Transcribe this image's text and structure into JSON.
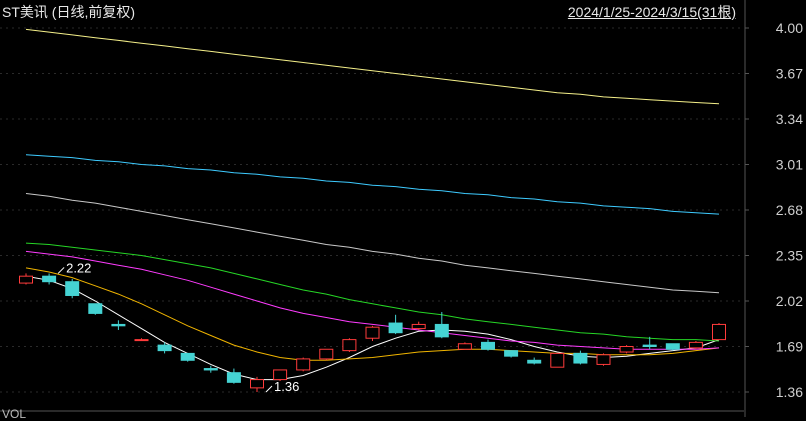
{
  "header": {
    "title": "ST美讯 (日线,前复权)",
    "range": "2024/1/25-2024/3/15(31根)"
  },
  "footer_label": "VOL",
  "colors": {
    "up": "#ff3b3b",
    "down": "#45d3d3",
    "grid": "#2a2a2a",
    "axis": "#555555"
  },
  "chart_data": {
    "type": "candlestick",
    "y_ticks": [
      "4.00",
      "3.67",
      "3.34",
      "3.01",
      "2.68",
      "2.35",
      "2.02",
      "1.69",
      "1.36"
    ],
    "ylim": [
      1.3,
      4.08
    ],
    "grid": true,
    "candles": [
      {
        "open": 2.15,
        "close": 2.2,
        "high": 2.22,
        "low": 2.14
      },
      {
        "open": 2.2,
        "close": 2.16,
        "high": 2.22,
        "low": 2.14
      },
      {
        "open": 2.16,
        "close": 2.06,
        "high": 2.18,
        "low": 2.04
      },
      {
        "open": 2.0,
        "close": 1.93,
        "high": 2.0,
        "low": 1.92
      },
      {
        "open": 1.85,
        "close": 1.84,
        "high": 1.88,
        "low": 1.81
      },
      {
        "open": 1.74,
        "close": 1.74,
        "high": 1.75,
        "low": 1.73
      },
      {
        "open": 1.7,
        "close": 1.66,
        "high": 1.72,
        "low": 1.64
      },
      {
        "open": 1.64,
        "close": 1.59,
        "high": 1.64,
        "low": 1.58
      },
      {
        "open": 1.53,
        "close": 1.52,
        "high": 1.55,
        "low": 1.5
      },
      {
        "open": 1.5,
        "close": 1.43,
        "high": 1.53,
        "low": 1.42
      },
      {
        "open": 1.39,
        "close": 1.45,
        "high": 1.47,
        "low": 1.36
      },
      {
        "open": 1.45,
        "close": 1.52,
        "high": 1.52,
        "low": 1.44
      },
      {
        "open": 1.52,
        "close": 1.6,
        "high": 1.61,
        "low": 1.51
      },
      {
        "open": 1.6,
        "close": 1.67,
        "high": 1.67,
        "low": 1.59
      },
      {
        "open": 1.66,
        "close": 1.74,
        "high": 1.75,
        "low": 1.65
      },
      {
        "open": 1.75,
        "close": 1.83,
        "high": 1.84,
        "low": 1.73
      },
      {
        "open": 1.86,
        "close": 1.79,
        "high": 1.92,
        "low": 1.78
      },
      {
        "open": 1.82,
        "close": 1.85,
        "high": 1.87,
        "low": 1.81
      },
      {
        "open": 1.85,
        "close": 1.76,
        "high": 1.94,
        "low": 1.75
      },
      {
        "open": 1.67,
        "close": 1.71,
        "high": 1.72,
        "low": 1.67
      },
      {
        "open": 1.72,
        "close": 1.67,
        "high": 1.74,
        "low": 1.66
      },
      {
        "open": 1.66,
        "close": 1.62,
        "high": 1.66,
        "low": 1.61
      },
      {
        "open": 1.59,
        "close": 1.57,
        "high": 1.61,
        "low": 1.56
      },
      {
        "open": 1.54,
        "close": 1.64,
        "high": 1.64,
        "low": 1.54
      },
      {
        "open": 1.64,
        "close": 1.57,
        "high": 1.66,
        "low": 1.56
      },
      {
        "open": 1.56,
        "close": 1.63,
        "high": 1.64,
        "low": 1.55
      },
      {
        "open": 1.65,
        "close": 1.69,
        "high": 1.7,
        "low": 1.64
      },
      {
        "open": 1.7,
        "close": 1.69,
        "high": 1.76,
        "low": 1.67
      },
      {
        "open": 1.71,
        "close": 1.67,
        "high": 1.71,
        "low": 1.66
      },
      {
        "open": 1.68,
        "close": 1.72,
        "high": 1.73,
        "low": 1.67
      },
      {
        "open": 1.74,
        "close": 1.85,
        "high": 1.86,
        "low": 1.74
      }
    ],
    "moving_averages": [
      {
        "color": "#ffffff",
        "values": [
          2.2,
          2.17,
          2.11,
          2.02,
          1.92,
          1.82,
          1.72,
          1.64,
          1.56,
          1.49,
          1.45,
          1.45,
          1.48,
          1.54,
          1.61,
          1.69,
          1.75,
          1.8,
          1.81,
          1.8,
          1.78,
          1.74,
          1.69,
          1.65,
          1.62,
          1.61,
          1.62,
          1.64,
          1.66,
          1.68,
          1.74
        ]
      },
      {
        "color": "#f0b400",
        "values": [
          2.26,
          2.23,
          2.19,
          2.13,
          2.07,
          2.0,
          1.92,
          1.84,
          1.77,
          1.7,
          1.65,
          1.61,
          1.59,
          1.59,
          1.6,
          1.61,
          1.63,
          1.65,
          1.66,
          1.67,
          1.67,
          1.66,
          1.65,
          1.64,
          1.64,
          1.63,
          1.63,
          1.63,
          1.64,
          1.66,
          1.68
        ]
      },
      {
        "color": "#ff3cff",
        "values": [
          2.38,
          2.36,
          2.34,
          2.31,
          2.28,
          2.25,
          2.21,
          2.17,
          2.12,
          2.07,
          2.02,
          1.97,
          1.93,
          1.9,
          1.87,
          1.85,
          1.83,
          1.81,
          1.79,
          1.77,
          1.75,
          1.73,
          1.72,
          1.7,
          1.69,
          1.68,
          1.67,
          1.67,
          1.67,
          1.67,
          1.68
        ]
      },
      {
        "color": "#26d626",
        "values": [
          2.44,
          2.43,
          2.41,
          2.39,
          2.37,
          2.35,
          2.32,
          2.29,
          2.26,
          2.22,
          2.18,
          2.14,
          2.1,
          2.07,
          2.03,
          2.0,
          1.97,
          1.94,
          1.92,
          1.89,
          1.87,
          1.85,
          1.83,
          1.81,
          1.79,
          1.78,
          1.76,
          1.75,
          1.74,
          1.74,
          1.73
        ]
      },
      {
        "color": "#c8c8c8",
        "values": [
          2.8,
          2.78,
          2.75,
          2.73,
          2.7,
          2.67,
          2.64,
          2.61,
          2.58,
          2.55,
          2.52,
          2.49,
          2.46,
          2.43,
          2.41,
          2.38,
          2.36,
          2.33,
          2.31,
          2.28,
          2.26,
          2.24,
          2.22,
          2.2,
          2.18,
          2.16,
          2.14,
          2.12,
          2.1,
          2.09,
          2.08
        ]
      },
      {
        "color": "#3ecbff",
        "values": [
          3.08,
          3.07,
          3.06,
          3.04,
          3.03,
          3.01,
          3.0,
          2.98,
          2.97,
          2.95,
          2.94,
          2.92,
          2.91,
          2.89,
          2.88,
          2.86,
          2.85,
          2.83,
          2.82,
          2.8,
          2.79,
          2.77,
          2.76,
          2.74,
          2.73,
          2.71,
          2.7,
          2.69,
          2.67,
          2.66,
          2.65
        ]
      },
      {
        "color": "#f5f08a",
        "values": [
          3.99,
          3.97,
          3.95,
          3.93,
          3.91,
          3.89,
          3.87,
          3.85,
          3.83,
          3.81,
          3.79,
          3.77,
          3.75,
          3.73,
          3.71,
          3.69,
          3.67,
          3.65,
          3.63,
          3.61,
          3.59,
          3.57,
          3.55,
          3.53,
          3.52,
          3.5,
          3.49,
          3.48,
          3.47,
          3.46,
          3.45
        ]
      }
    ],
    "annotations": [
      {
        "index": 1,
        "price": 2.22,
        "text": "2.22",
        "dir": "right"
      },
      {
        "index": 10,
        "price": 1.36,
        "text": "1.36",
        "dir": "right"
      }
    ]
  }
}
